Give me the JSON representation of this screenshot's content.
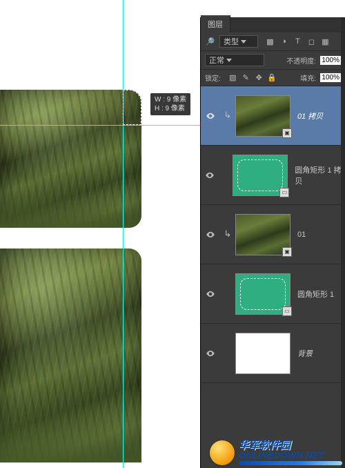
{
  "panel": {
    "tab_label": "图层",
    "filter": {
      "kind_label": "类型",
      "icons": [
        "image-icon",
        "adjust-icon",
        "text-icon",
        "shape-icon",
        "smart-icon"
      ]
    },
    "blend": {
      "mode": "正常",
      "opacity_label": "不透明度:",
      "opacity_value": "100%"
    },
    "lock": {
      "label": "锁定:",
      "fill_label": "填充:",
      "fill_value": "100%",
      "icons": [
        "lock-pixels",
        "lock-brush",
        "lock-move",
        "lock-all"
      ]
    },
    "layers": [
      {
        "name": "01 拷贝",
        "thumb": "jungle",
        "selected": true,
        "clipped": true,
        "smart": true
      },
      {
        "name": "圆角矩形 1 拷贝",
        "thumb": "green",
        "selected": false,
        "clipped": false,
        "smart": false,
        "vector": true
      },
      {
        "name": "01",
        "thumb": "jungle",
        "selected": false,
        "clipped": true,
        "smart": true
      },
      {
        "name": "圆角矩形 1",
        "thumb": "green",
        "selected": false,
        "clipped": false,
        "smart": false,
        "vector": true
      },
      {
        "name": "背景",
        "thumb": "white",
        "selected": false,
        "clipped": false,
        "smart": false
      }
    ]
  },
  "tooltip": {
    "line1": "W : 9 像素",
    "line2": "H : 9 像素"
  },
  "watermark": {
    "cn": "华军软件园",
    "en": "ONLINEDOWN.NET"
  }
}
